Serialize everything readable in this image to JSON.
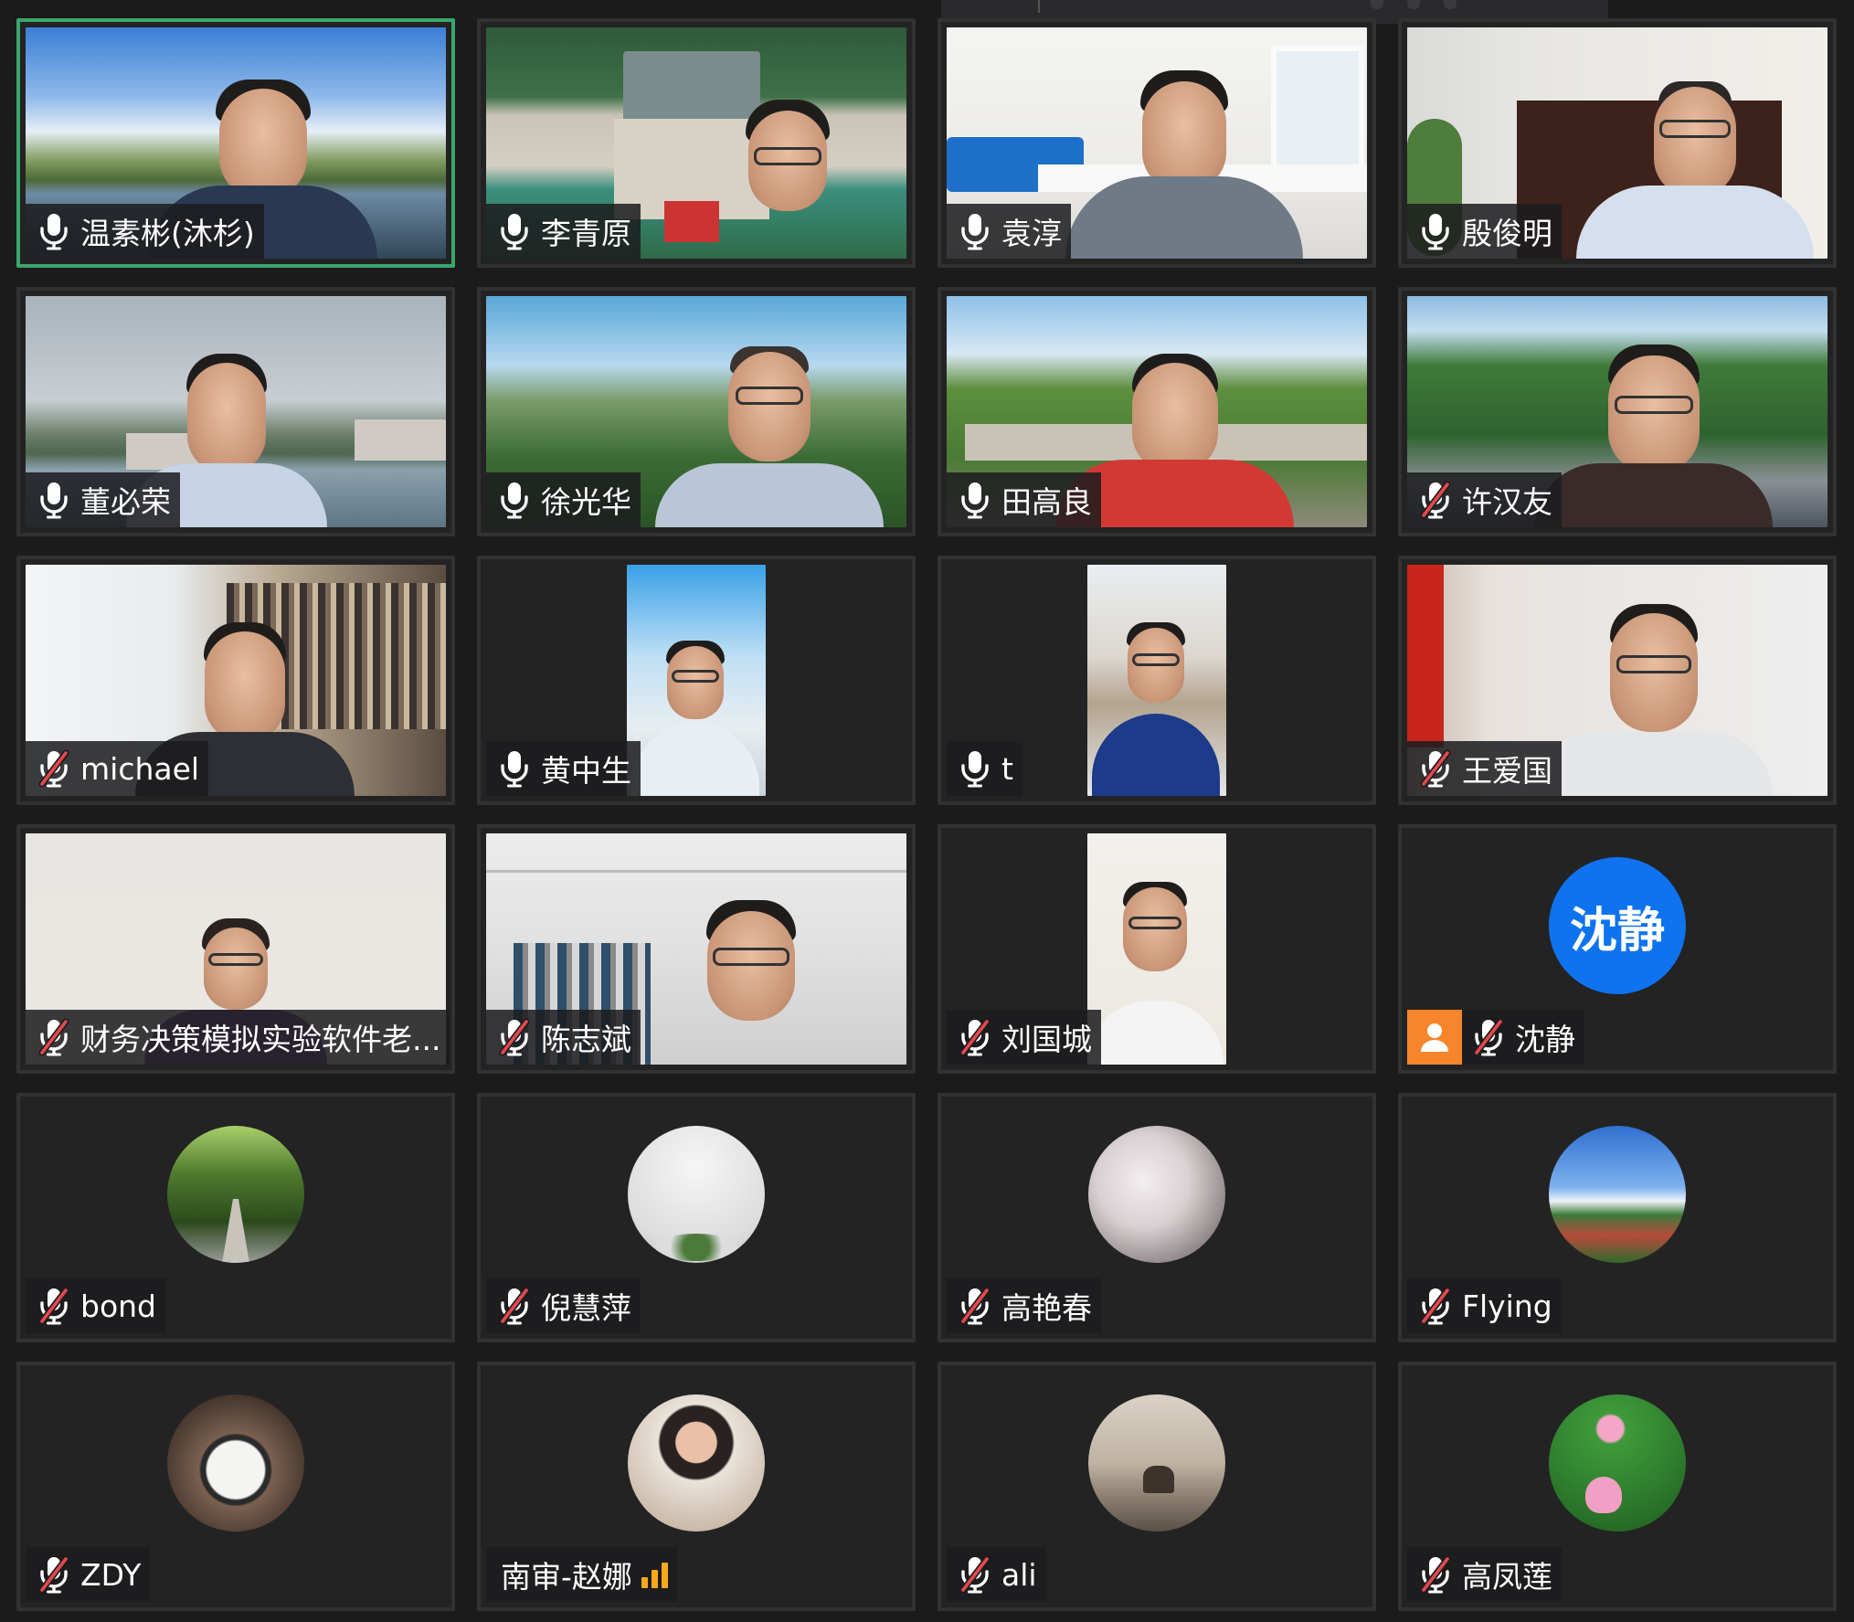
{
  "participants": [
    {
      "name": "温素彬(沐杉)",
      "mic": "on",
      "speaking": true
    },
    {
      "name": "李青原",
      "mic": "on"
    },
    {
      "name": "袁淳",
      "mic": "on"
    },
    {
      "name": "殷俊明",
      "mic": "on"
    },
    {
      "name": "董必荣",
      "mic": "on"
    },
    {
      "name": "徐光华",
      "mic": "on"
    },
    {
      "name": "田高良",
      "mic": "on"
    },
    {
      "name": "许汉友",
      "mic": "muted"
    },
    {
      "name": "michael",
      "mic": "muted"
    },
    {
      "name": "黄中生",
      "mic": "on"
    },
    {
      "name": "t",
      "mic": "on"
    },
    {
      "name": "王爱国",
      "mic": "muted"
    },
    {
      "name": "财务决策模拟实验软件老...",
      "mic": "muted"
    },
    {
      "name": "陈志斌",
      "mic": "muted"
    },
    {
      "name": "刘国城",
      "mic": "muted"
    },
    {
      "name": "沈静",
      "mic": "muted",
      "avatar_text": "沈静"
    },
    {
      "name": "bond",
      "mic": "muted"
    },
    {
      "name": "倪慧萍",
      "mic": "muted"
    },
    {
      "name": "高艳春",
      "mic": "muted"
    },
    {
      "name": "Flying",
      "mic": "muted"
    },
    {
      "name": "ZDY",
      "mic": "muted"
    },
    {
      "name": "南审-赵娜",
      "mic": "none"
    },
    {
      "name": "ali",
      "mic": "muted"
    },
    {
      "name": "高凤莲",
      "mic": "muted"
    }
  ],
  "colors": {
    "speaking_border": "#3aa76d",
    "avatar_blue": "#0f73f0",
    "muted_red": "#e5484d",
    "signal_orange": "#f7a81b",
    "guest_orange": "#f7852b"
  }
}
